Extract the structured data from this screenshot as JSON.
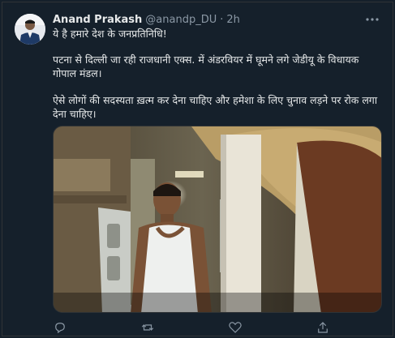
{
  "tweet": {
    "author_name": "Anand Prakash",
    "author_handle": "@anandp_DU",
    "separator": "·",
    "time": "2h",
    "more_icon": "more-horizontal-icon",
    "text_line1": "ये है हमारे देश के जनप्रतिनिधि!",
    "text_line2": "पटना से दिल्ली जा रही राजधानी एक्स. में अंडरवियर में घूमने लगे जेडीयू के विधायक गोपाल मंडल।",
    "text_line3": "ऐसे लोगों की सदस्यता ख़त्म कर देना चाहिए और हमेशा के लिए चुनाव लड़ने पर रोक लगा देना चाहिए।"
  },
  "colors": {
    "background": "#15202b",
    "text": "#e7e9ea",
    "muted": "#8b98a5",
    "border": "#2f3336"
  }
}
